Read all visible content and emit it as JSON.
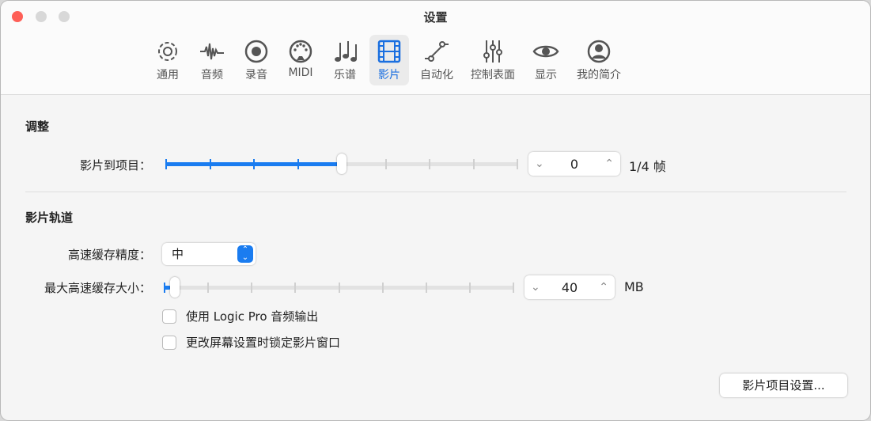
{
  "window": {
    "title": "设置"
  },
  "tabs": [
    {
      "label": "通用",
      "icon": "gear-icon"
    },
    {
      "label": "音频",
      "icon": "waveform-icon"
    },
    {
      "label": "录音",
      "icon": "record-icon"
    },
    {
      "label": "MIDI",
      "icon": "midi-icon"
    },
    {
      "label": "乐谱",
      "icon": "notes-icon"
    },
    {
      "label": "影片",
      "icon": "film-icon",
      "active": true
    },
    {
      "label": "自动化",
      "icon": "automation-icon"
    },
    {
      "label": "控制表面",
      "icon": "sliders-icon"
    },
    {
      "label": "显示",
      "icon": "eye-icon"
    },
    {
      "label": "我的简介",
      "icon": "profile-icon"
    }
  ],
  "adjust": {
    "heading": "调整",
    "label": "影片到项目：",
    "value": "0",
    "unit": "1/4 帧",
    "slider_fraction": 0.5
  },
  "movie_track": {
    "heading": "影片轨道",
    "cache_precision_label": "高速缓存精度：",
    "cache_precision_value": "中",
    "cache_size_label": "最大高速缓存大小：",
    "cache_size_value": "40",
    "cache_unit": "MB",
    "slider_fraction": 0.02,
    "checkboxes": [
      {
        "label": "使用 Logic Pro 音频输出",
        "checked": false
      },
      {
        "label": "更改屏幕设置时锁定影片窗口",
        "checked": false
      }
    ]
  },
  "button": {
    "label": "影片项目设置..."
  },
  "colors": {
    "accent": "#1a7cf0"
  }
}
